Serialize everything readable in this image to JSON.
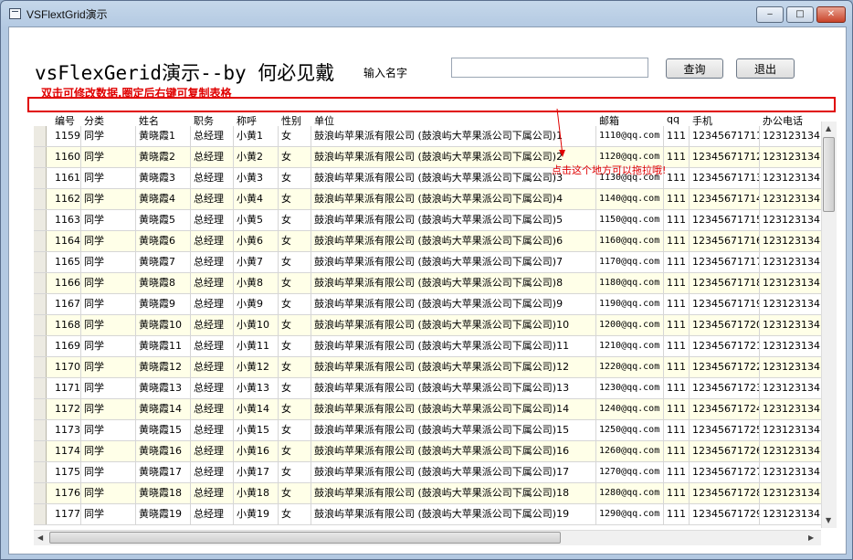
{
  "window": {
    "title": "VSFlextGrid演示",
    "minimize": "‒",
    "maximize": "□",
    "close": "✕"
  },
  "header": {
    "title": "vsFlexGerid演示--by 何必见戴",
    "name_label": "输入名字",
    "name_value": "",
    "query_button": "查询",
    "exit_button": "退出"
  },
  "hint": "双击可修改数据,圈定后右键可复制表格",
  "annotation": "点击这个地方可以拖拉哦!",
  "grid": {
    "columns": [
      "编号",
      "分类",
      "姓名",
      "职务",
      "称呼",
      "性别",
      "单位",
      "",
      "邮箱",
      "qq",
      "手机",
      "办公电话"
    ],
    "rows": [
      [
        "1159",
        "同学",
        "黄晓霞1",
        "总经理",
        "小黄1",
        "女",
        "鼓浪屿苹果派有限公司 (鼓浪屿大苹果派公司下属公司)1",
        "1110@qq.com",
        "111",
        "12345671711",
        "123123134"
      ],
      [
        "1160",
        "同学",
        "黄晓霞2",
        "总经理",
        "小黄2",
        "女",
        "鼓浪屿苹果派有限公司 (鼓浪屿大苹果派公司下属公司)2",
        "1120@qq.com",
        "111",
        "12345671712",
        "123123134"
      ],
      [
        "1161",
        "同学",
        "黄晓霞3",
        "总经理",
        "小黄3",
        "女",
        "鼓浪屿苹果派有限公司 (鼓浪屿大苹果派公司下属公司)3",
        "1130@qq.com",
        "111",
        "12345671713",
        "123123134"
      ],
      [
        "1162",
        "同学",
        "黄晓霞4",
        "总经理",
        "小黄4",
        "女",
        "鼓浪屿苹果派有限公司 (鼓浪屿大苹果派公司下属公司)4",
        "1140@qq.com",
        "111",
        "12345671714",
        "123123134"
      ],
      [
        "1163",
        "同学",
        "黄晓霞5",
        "总经理",
        "小黄5",
        "女",
        "鼓浪屿苹果派有限公司 (鼓浪屿大苹果派公司下属公司)5",
        "1150@qq.com",
        "111",
        "12345671715",
        "123123134"
      ],
      [
        "1164",
        "同学",
        "黄晓霞6",
        "总经理",
        "小黄6",
        "女",
        "鼓浪屿苹果派有限公司 (鼓浪屿大苹果派公司下属公司)6",
        "1160@qq.com",
        "111",
        "12345671716",
        "123123134"
      ],
      [
        "1165",
        "同学",
        "黄晓霞7",
        "总经理",
        "小黄7",
        "女",
        "鼓浪屿苹果派有限公司 (鼓浪屿大苹果派公司下属公司)7",
        "1170@qq.com",
        "111",
        "12345671717",
        "123123134"
      ],
      [
        "1166",
        "同学",
        "黄晓霞8",
        "总经理",
        "小黄8",
        "女",
        "鼓浪屿苹果派有限公司 (鼓浪屿大苹果派公司下属公司)8",
        "1180@qq.com",
        "111",
        "12345671718",
        "123123134"
      ],
      [
        "1167",
        "同学",
        "黄晓霞9",
        "总经理",
        "小黄9",
        "女",
        "鼓浪屿苹果派有限公司 (鼓浪屿大苹果派公司下属公司)9",
        "1190@qq.com",
        "111",
        "12345671719",
        "123123134"
      ],
      [
        "1168",
        "同学",
        "黄晓霞10",
        "总经理",
        "小黄10",
        "女",
        "鼓浪屿苹果派有限公司 (鼓浪屿大苹果派公司下属公司)10",
        "1200@qq.com",
        "111",
        "12345671720",
        "123123134"
      ],
      [
        "1169",
        "同学",
        "黄晓霞11",
        "总经理",
        "小黄11",
        "女",
        "鼓浪屿苹果派有限公司 (鼓浪屿大苹果派公司下属公司)11",
        "1210@qq.com",
        "111",
        "12345671721",
        "123123134"
      ],
      [
        "1170",
        "同学",
        "黄晓霞12",
        "总经理",
        "小黄12",
        "女",
        "鼓浪屿苹果派有限公司 (鼓浪屿大苹果派公司下属公司)12",
        "1220@qq.com",
        "111",
        "12345671722",
        "123123134"
      ],
      [
        "1171",
        "同学",
        "黄晓霞13",
        "总经理",
        "小黄13",
        "女",
        "鼓浪屿苹果派有限公司 (鼓浪屿大苹果派公司下属公司)13",
        "1230@qq.com",
        "111",
        "12345671723",
        "123123134"
      ],
      [
        "1172",
        "同学",
        "黄晓霞14",
        "总经理",
        "小黄14",
        "女",
        "鼓浪屿苹果派有限公司 (鼓浪屿大苹果派公司下属公司)14",
        "1240@qq.com",
        "111",
        "12345671724",
        "123123134"
      ],
      [
        "1173",
        "同学",
        "黄晓霞15",
        "总经理",
        "小黄15",
        "女",
        "鼓浪屿苹果派有限公司 (鼓浪屿大苹果派公司下属公司)15",
        "1250@qq.com",
        "111",
        "12345671725",
        "123123134"
      ],
      [
        "1174",
        "同学",
        "黄晓霞16",
        "总经理",
        "小黄16",
        "女",
        "鼓浪屿苹果派有限公司 (鼓浪屿大苹果派公司下属公司)16",
        "1260@qq.com",
        "111",
        "12345671726",
        "123123134"
      ],
      [
        "1175",
        "同学",
        "黄晓霞17",
        "总经理",
        "小黄17",
        "女",
        "鼓浪屿苹果派有限公司 (鼓浪屿大苹果派公司下属公司)17",
        "1270@qq.com",
        "111",
        "12345671727",
        "123123134"
      ],
      [
        "1176",
        "同学",
        "黄晓霞18",
        "总经理",
        "小黄18",
        "女",
        "鼓浪屿苹果派有限公司 (鼓浪屿大苹果派公司下属公司)18",
        "1280@qq.com",
        "111",
        "12345671728",
        "123123134"
      ],
      [
        "1177",
        "同学",
        "黄晓霞19",
        "总经理",
        "小黄19",
        "女",
        "鼓浪屿苹果派有限公司 (鼓浪屿大苹果派公司下属公司)19",
        "1290@qq.com",
        "111",
        "12345671729",
        "123123134"
      ]
    ]
  },
  "colors": {
    "hint_red": "#e00000",
    "odd_row": "#ffffe8",
    "title_bar": "#b3c9e2"
  },
  "icons": {
    "app": "window-app-icon",
    "scroll_up": "arrow-up-icon",
    "scroll_down": "arrow-down-icon",
    "scroll_left": "arrow-left-icon",
    "scroll_right": "arrow-right-icon"
  }
}
